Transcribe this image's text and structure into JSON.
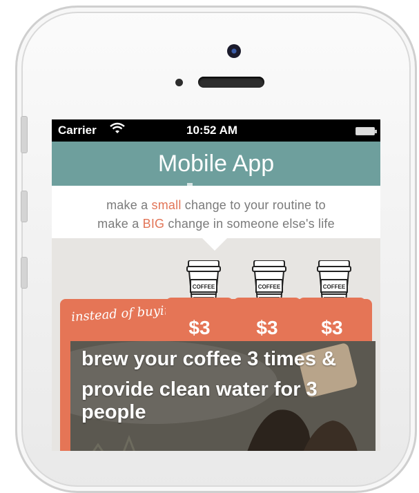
{
  "status_bar": {
    "carrier": "Carrier",
    "time": "10:52 AM"
  },
  "header": {
    "title": "Mobile App"
  },
  "tagline": {
    "line1": {
      "a": "make a ",
      "accent": "small",
      "b": " change to your routine to"
    },
    "line2": {
      "a": "make a ",
      "accent": "BIG",
      "b": " change in someone else's life"
    }
  },
  "cups": [
    {
      "label": "COFFEE"
    },
    {
      "label": "COFFEE"
    },
    {
      "label": "COFFEE"
    }
  ],
  "card": {
    "instead_text": "instead of buying...",
    "prices": [
      "$3",
      "$3",
      "$3"
    ],
    "photo_line1": "brew your coffee 3 times &",
    "photo_line2": "provide clean water for 3 people"
  },
  "colors": {
    "header_bg": "#6e9f9d",
    "accent": "#e27456",
    "card_bg": "#e57556"
  }
}
